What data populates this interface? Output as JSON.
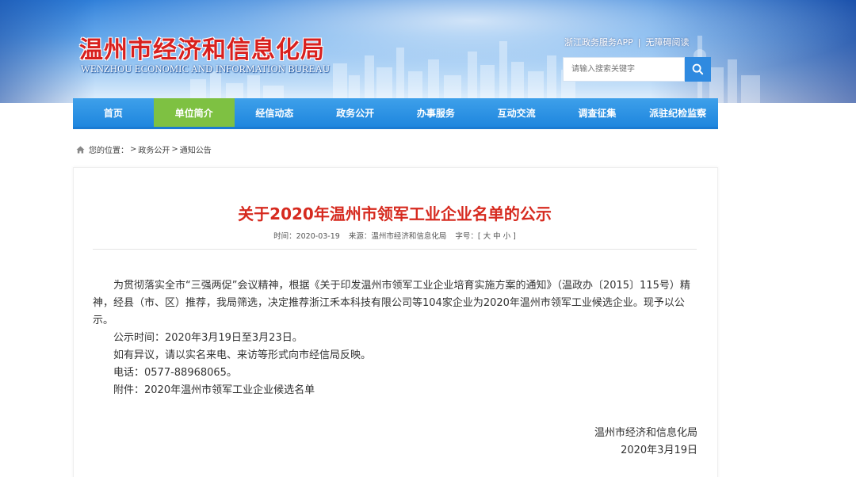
{
  "header": {
    "title_cn": "温州市经济和信息化局",
    "title_en": "WENZHOU ECONOMIC AND INFORMATION BUREAU",
    "links": [
      "浙江政务服务APP",
      "无障碍阅读"
    ],
    "link_separator": "|",
    "search": {
      "placeholder": "请输入搜索关键字"
    },
    "search_icon": "search-icon"
  },
  "nav": {
    "items": [
      {
        "label": "首页"
      },
      {
        "label": "单位简介"
      },
      {
        "label": "经信动态"
      },
      {
        "label": "政务公开"
      },
      {
        "label": "办事服务"
      },
      {
        "label": "互动交流"
      },
      {
        "label": "调查征集"
      },
      {
        "label": "派驻纪检监察"
      }
    ],
    "active_index": 1
  },
  "breadcrumb": {
    "home_icon": "home-icon",
    "prefix": "您的位置：",
    "sep": ">",
    "items": [
      "政务公开",
      "通知公告"
    ]
  },
  "article": {
    "title": "关于2020年温州市领军工业企业名单的公示",
    "meta": {
      "time": "时间：2020-03-19",
      "source": "来源：温州市经济和信息化局",
      "font_size": "字号：[ 大 中 小 ]"
    },
    "paragraphs": [
      "为贯彻落实全市“三强两促”会议精神，根据《关于印发温州市领军工业企业培育实施方案的通知》（温政办〔2015〕115号）精神，经县（市、区）推荐，我局筛选，决定推荐浙江禾本科技有限公司等104家企业为2020年温州市领军工业候选企业。现予以公示。"
    ],
    "lines": [
      "公示时间：2020年3月19日至3月23日。",
      "如有异议，请以实名来电、来访等形式向市经信局反映。",
      "电话：0577-88968065。",
      "附件：2020年温州市领军工业企业候选名单"
    ],
    "signature": {
      "org": "温州市经济和信息化局",
      "date": "2020年3月19日"
    }
  },
  "colors": {
    "title_red": "#d62a1f",
    "nav_blue": "#1e86de",
    "nav_active_green": "#7ec142",
    "logo_red": "#d8201e"
  }
}
